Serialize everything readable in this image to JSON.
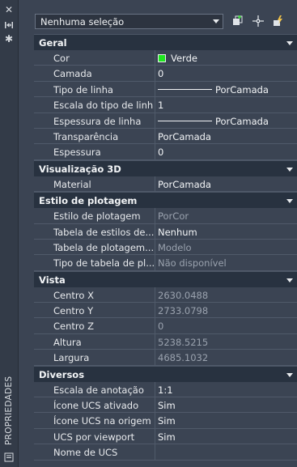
{
  "window": {
    "title": "PROPRIEDADES"
  },
  "selection": {
    "value": "Nenhuma seleção"
  },
  "colors": {
    "layer_color": "#1fe81f"
  },
  "sections": [
    {
      "title": "Geral",
      "rows": [
        {
          "key": "Cor",
          "value": "Verde",
          "swatch": true,
          "dim": false
        },
        {
          "key": "Camada",
          "value": "0",
          "dim": false
        },
        {
          "key": "Tipo de linha",
          "value": "PorCamada",
          "line": true,
          "dim": false
        },
        {
          "key": "Escala do tipo de linha",
          "value": "1",
          "dim": false
        },
        {
          "key": "Espessura de linha",
          "value": "PorCamada",
          "line": true,
          "dim": false
        },
        {
          "key": "Transparência",
          "value": "PorCamada",
          "dim": false
        },
        {
          "key": "Espessura",
          "value": "0",
          "dim": false
        }
      ]
    },
    {
      "title": "Visualização 3D",
      "rows": [
        {
          "key": "Material",
          "value": "PorCamada",
          "dim": false
        }
      ]
    },
    {
      "title": "Estilo de plotagem",
      "rows": [
        {
          "key": "Estilo de plotagem",
          "value": "PorCor",
          "dim": true
        },
        {
          "key": "Tabela de estilos de...",
          "value": "Nenhum",
          "dim": false
        },
        {
          "key": "Tabela de plotagem...",
          "value": "Modelo",
          "dim": true
        },
        {
          "key": "Tipo de tabela de pl...",
          "value": "Não disponível",
          "dim": true
        }
      ]
    },
    {
      "title": "Vista",
      "rows": [
        {
          "key": "Centro X",
          "value": "2630.0488",
          "dim": true
        },
        {
          "key": "Centro Y",
          "value": "2733.0798",
          "dim": true
        },
        {
          "key": "Centro Z",
          "value": "0",
          "dim": true
        },
        {
          "key": "Altura",
          "value": "5238.5215",
          "dim": true
        },
        {
          "key": "Largura",
          "value": "4685.1032",
          "dim": true
        }
      ]
    },
    {
      "title": "Diversos",
      "rows": [
        {
          "key": "Escala de anotação",
          "value": "1:1",
          "dim": false
        },
        {
          "key": "Ícone UCS ativado",
          "value": "Sim",
          "dim": false
        },
        {
          "key": "Ícone UCS na origem",
          "value": "Sim",
          "dim": false
        },
        {
          "key": "UCS por viewport",
          "value": "Sim",
          "dim": false
        },
        {
          "key": "Nome de UCS",
          "value": "",
          "dim": false
        }
      ]
    }
  ]
}
